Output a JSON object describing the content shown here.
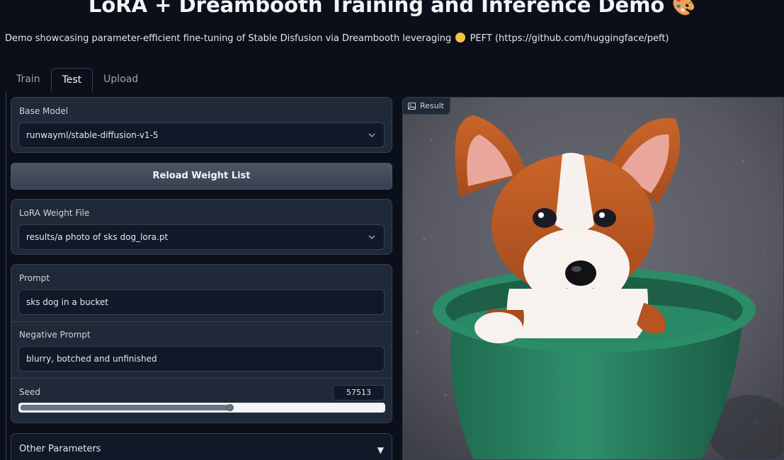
{
  "header": {
    "title": "LoRA + Dreambooth Training and Inference Demo",
    "title_emoji": "🎨",
    "subtitle_before": "Demo showcasing parameter-efficient fine-tuning of Stable Disfusion via Dreambooth leveraging",
    "subtitle_after": "PEFT (https://github.com/huggingface/peft)"
  },
  "tabs": [
    {
      "label": "Train",
      "active": false
    },
    {
      "label": "Test",
      "active": true
    },
    {
      "label": "Upload",
      "active": false
    }
  ],
  "base_model": {
    "label": "Base Model",
    "value": "runwayml/stable-diffusion-v1-5"
  },
  "reload_button": {
    "label": "Reload Weight List"
  },
  "lora_weight": {
    "label": "LoRA Weight File",
    "value": "results/a photo of sks dog_lora.pt"
  },
  "prompt": {
    "label": "Prompt",
    "value": "sks dog in a bucket"
  },
  "negative_prompt": {
    "label": "Negative Prompt",
    "value": "blurry, botched and unfinished"
  },
  "seed": {
    "label": "Seed",
    "value": "57513",
    "slider_fraction": 0.575
  },
  "other_parameters": {
    "label": "Other Parameters",
    "toggle_glyph": "▼"
  },
  "result": {
    "label": "Result",
    "icon": "image-icon"
  },
  "colors": {
    "background": "#0b0f19",
    "panel": "#1f2937",
    "border": "#374151",
    "bucket": "#2f8b6a"
  }
}
